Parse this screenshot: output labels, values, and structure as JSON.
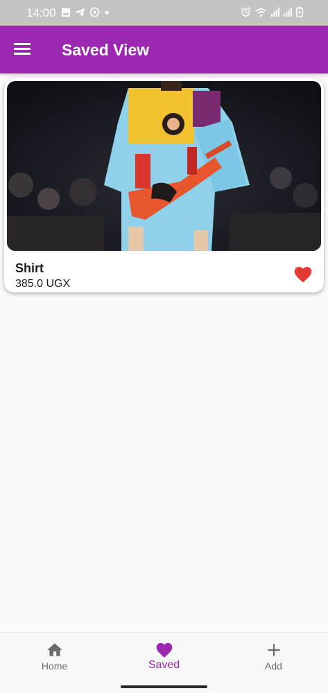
{
  "status_bar": {
    "time": "14:00",
    "left_icons": [
      "image-icon",
      "telegram-icon",
      "whatsapp-icon",
      "dot-icon"
    ],
    "right_icons": [
      "alarm-icon",
      "wifi-icon",
      "signal-icon",
      "signal-icon",
      "battery-icon"
    ]
  },
  "app_bar": {
    "title": "Saved View",
    "menu_icon": "menu-icon"
  },
  "saved_items": [
    {
      "name": "Shirt",
      "price": "385.0 UGX",
      "favorite": true,
      "favorite_color": "#e53935"
    }
  ],
  "bottom_nav": {
    "items": [
      {
        "label": "Home",
        "icon": "home-icon",
        "active": false
      },
      {
        "label": "Saved",
        "icon": "heart-icon",
        "active": true
      },
      {
        "label": "Add",
        "icon": "plus-icon",
        "active": false
      }
    ],
    "active_color": "#9c27b0",
    "inactive_color": "#6b6b6b"
  },
  "colors": {
    "primary": "#9c27b0",
    "status_bar": "#c4c4c4",
    "background": "#fafafa"
  }
}
